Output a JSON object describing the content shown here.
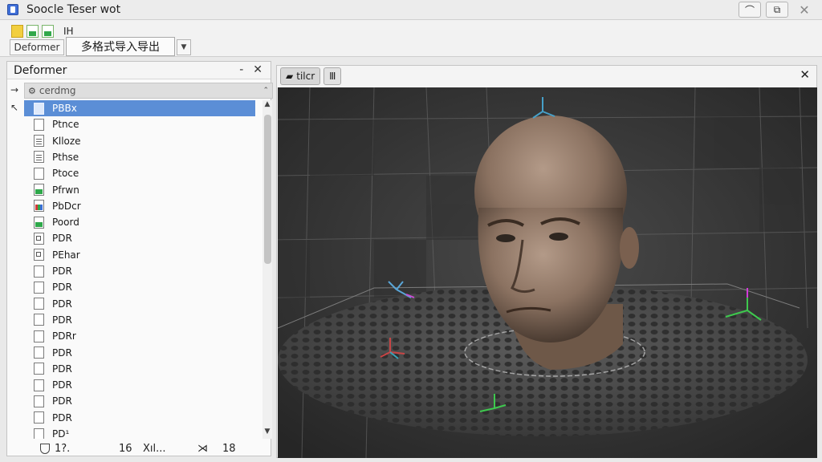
{
  "window": {
    "title": "Soocle Teser wot"
  },
  "toolbar": {
    "label": "IH",
    "deformer_button": "Deformer",
    "import_export_button": "多格式导入导出"
  },
  "left_panel": {
    "title": "Deformer",
    "search_text": "cerdmg",
    "items": [
      {
        "label": "PBBx",
        "icon": "blank-file-icon",
        "selected": true
      },
      {
        "label": "Ptnce",
        "icon": "blank-file-icon"
      },
      {
        "label": "Klloze",
        "icon": "text-file-icon"
      },
      {
        "label": "Pthse",
        "icon": "text-file-icon"
      },
      {
        "label": "Ptoce",
        "icon": "blank-file-icon"
      },
      {
        "label": "Pfrwn",
        "icon": "image-file-icon"
      },
      {
        "label": "PbDcr",
        "icon": "chart-file-icon"
      },
      {
        "label": "Poord",
        "icon": "image-file-icon"
      },
      {
        "label": "PDR",
        "icon": "doc-file-icon"
      },
      {
        "label": "PEhar",
        "icon": "doc-file-icon"
      },
      {
        "label": "PDR",
        "icon": "blank-file-icon"
      },
      {
        "label": "PDR",
        "icon": "blank-file-icon"
      },
      {
        "label": "PDR",
        "icon": "blank-file-icon"
      },
      {
        "label": "PDR",
        "icon": "blank-file-icon"
      },
      {
        "label": "PDRr",
        "icon": "blank-file-icon"
      },
      {
        "label": "PDR",
        "icon": "blank-file-icon"
      },
      {
        "label": "PDR",
        "icon": "blank-file-icon"
      },
      {
        "label": "PDR",
        "icon": "blank-file-icon"
      },
      {
        "label": "PDR",
        "icon": "blank-file-icon"
      },
      {
        "label": "PDR",
        "icon": "blank-file-icon"
      },
      {
        "label": "PD¹",
        "icon": "blank-file-icon"
      }
    ],
    "status": {
      "a": "1?.",
      "b": "16",
      "c": "Xıl...",
      "d": "18"
    }
  },
  "viewport": {
    "tab_label": "tilcr",
    "tab2_label": "Ⅲ"
  }
}
